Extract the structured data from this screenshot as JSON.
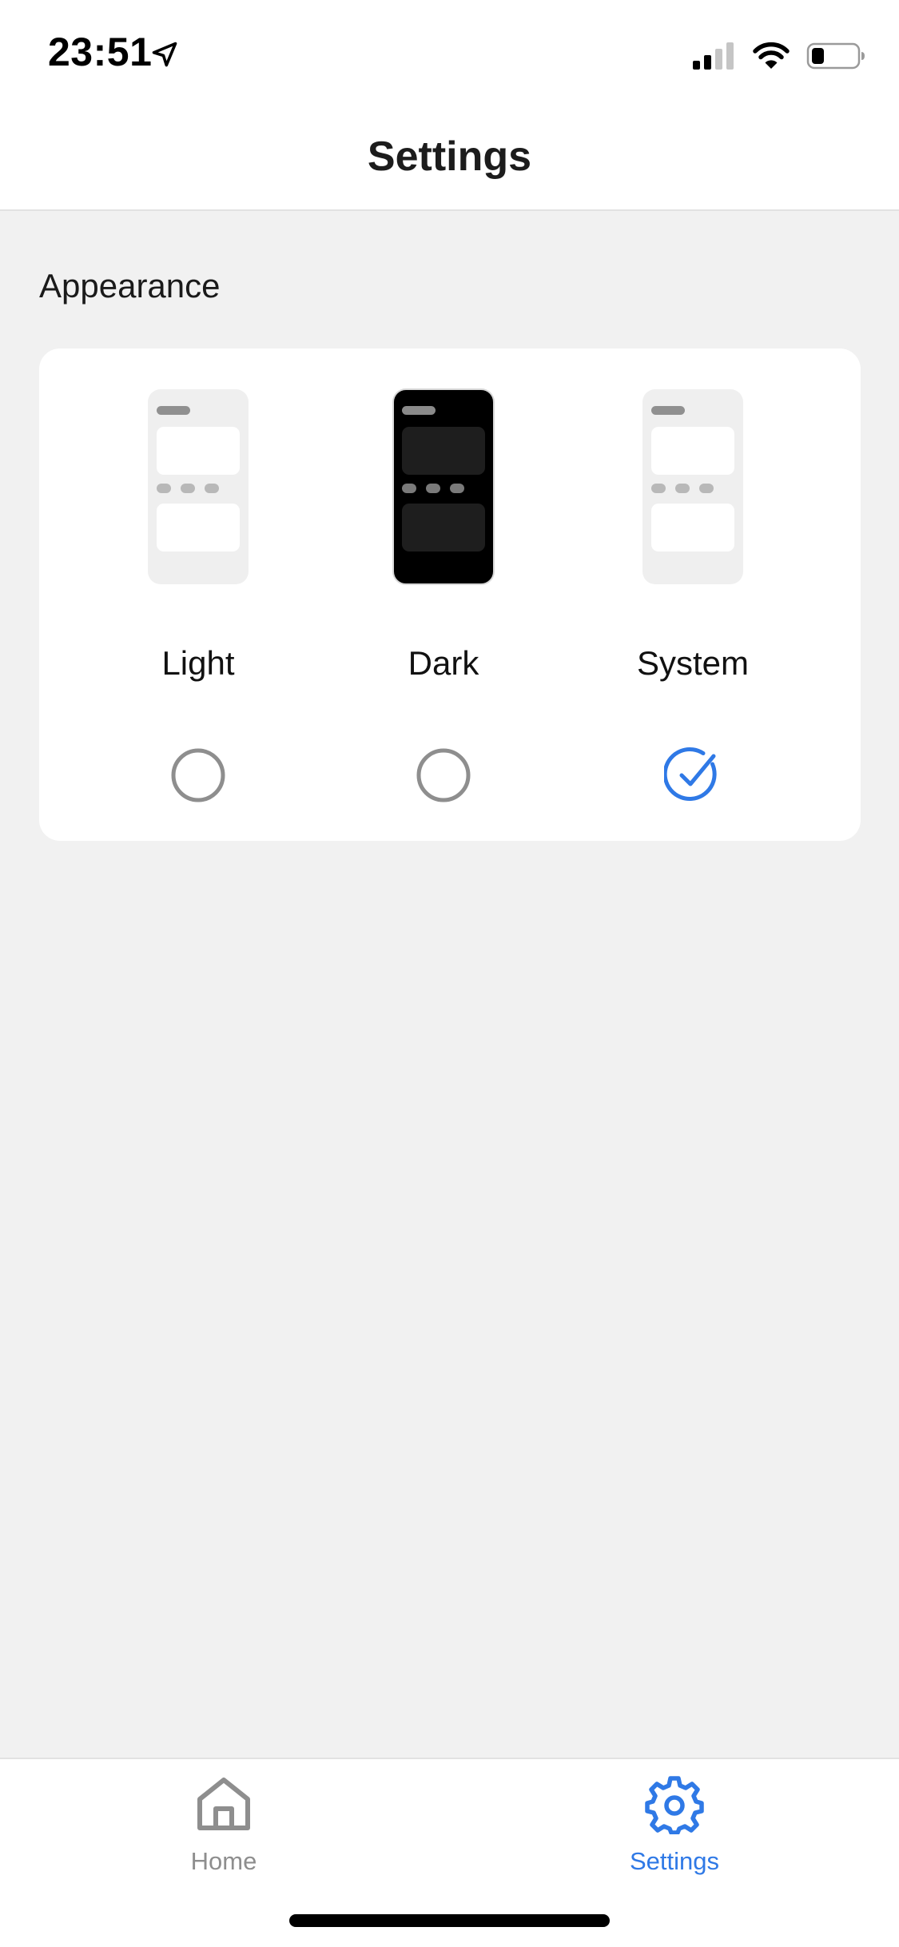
{
  "status_bar": {
    "time": "23:51",
    "icons": [
      "location-arrow-icon",
      "cellular-signal-icon",
      "wifi-icon",
      "battery-icon"
    ]
  },
  "header": {
    "title": "Settings"
  },
  "appearance": {
    "section_label": "Appearance",
    "options": [
      {
        "label": "Light",
        "selected": false,
        "preview_icon": "light-phone-preview-icon"
      },
      {
        "label": "Dark",
        "selected": false,
        "preview_icon": "dark-phone-preview-icon"
      },
      {
        "label": "System",
        "selected": true,
        "preview_icon": "system-phone-preview-icon"
      }
    ]
  },
  "tab_bar": {
    "items": [
      {
        "label": "Home",
        "icon": "home-icon",
        "active": false
      },
      {
        "label": "Settings",
        "icon": "gear-icon",
        "active": true
      }
    ]
  },
  "colors": {
    "accent": "#2f79e6",
    "inactive": "#8e8e8e",
    "background": "#f1f1f1",
    "card": "#ffffff"
  }
}
